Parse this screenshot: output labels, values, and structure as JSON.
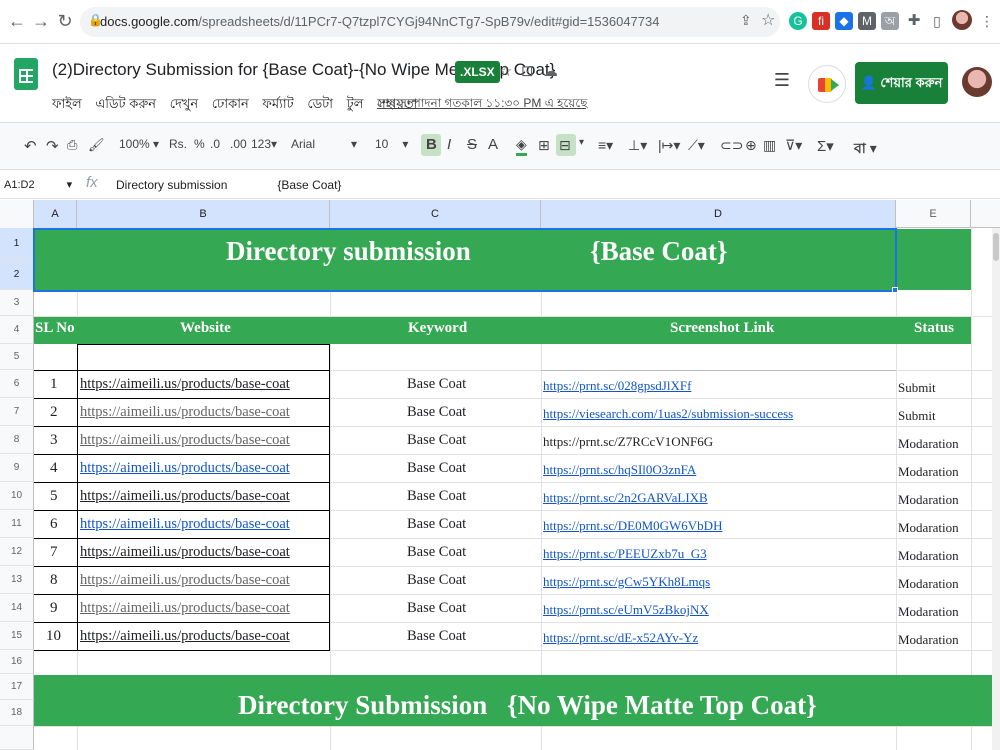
{
  "browser": {
    "url_host": "docs.google.com",
    "url_path": "/spreadsheets/d/11PCr7-Q7tzpl7CYGj94NnCTg7-SpB79v/edit#gid=1536047734"
  },
  "doc": {
    "title": "(2)Directory Submission for {Base Coat}-{No Wipe Metta Top Coat}",
    "badge": ".XLSX",
    "menu": [
      "ফাইল",
      "এডিট করুন",
      "দেখুন",
      "ঢোকান",
      "ফর্ম্যাট",
      "ডেটা",
      "টুল",
      "সহায়তা"
    ],
    "last_edit": "শেষ সম্পাদনা গতকাল ১১:৩০ PM এ হয়েছে",
    "share_label": "শেয়ার করুন"
  },
  "toolbar": {
    "zoom": "100%",
    "currency": "Rs.",
    "percent": "%",
    "dec_decrease": ".0",
    "dec_increase": ".00",
    "format_more": "123",
    "font": "Arial",
    "font_size": "10",
    "bold": "B",
    "italic": "I",
    "strike": "S",
    "text_color": "A",
    "lang": "বা"
  },
  "formula_bar": {
    "cell_ref": "A1:D2",
    "value": "Directory submission               {Base Coat}"
  },
  "columns": [
    "A",
    "B",
    "C",
    "D",
    "E"
  ],
  "rows": [
    "1",
    "2",
    "3",
    "4",
    "5",
    "6",
    "7",
    "8",
    "9",
    "10",
    "11",
    "12",
    "13",
    "14",
    "15",
    "16",
    "17",
    "18"
  ],
  "sheet": {
    "banner1": {
      "left": "Directory submission",
      "right": "{Base Coat}"
    },
    "headers": {
      "sl": "SL No",
      "website": "Website",
      "keyword": "Keyword",
      "link": "Screenshot Link",
      "status": "Status"
    },
    "entries": [
      {
        "sl": "1",
        "website": "https://aimeili.us/products/base-coat",
        "keyword": "Base Coat",
        "link": "https://prnt.sc/028gpsdJlXFf",
        "status": "Submit"
      },
      {
        "sl": "2",
        "website": "https://aimeili.us/products/base-coat",
        "keyword": "Base Coat",
        "link": "https://viesearch.com/1uas2/submission-success",
        "status": "Submit"
      },
      {
        "sl": "3",
        "website": "https://aimeili.us/products/base-coat",
        "keyword": "Base Coat",
        "link": "https://prnt.sc/Z7RCcV1ONF6G",
        "status": "Modaration"
      },
      {
        "sl": "4",
        "website": "https://aimeili.us/products/base-coat",
        "keyword": "Base Coat",
        "link": "https://prnt.sc/hqSIl0O3znFA",
        "status": "Modaration"
      },
      {
        "sl": "5",
        "website": "https://aimeili.us/products/base-coat",
        "keyword": "Base Coat",
        "link": "https://prnt.sc/2n2GARVaLIXB",
        "status": "Modaration"
      },
      {
        "sl": "6",
        "website": "https://aimeili.us/products/base-coat",
        "keyword": "Base Coat",
        "link": "https://prnt.sc/DE0M0GW6VbDH",
        "status": "Modaration"
      },
      {
        "sl": "7",
        "website": "https://aimeili.us/products/base-coat",
        "keyword": "Base Coat",
        "link": "https://prnt.sc/PEEUZxb7u_G3",
        "status": "Modaration"
      },
      {
        "sl": "8",
        "website": "https://aimeili.us/products/base-coat",
        "keyword": "Base Coat",
        "link": "https://prnt.sc/gCw5YKh8Lmqs",
        "status": "Modaration"
      },
      {
        "sl": "9",
        "website": "https://aimeili.us/products/base-coat",
        "keyword": "Base Coat",
        "link": "https://prnt.sc/eUmV5zBkojNX",
        "status": "Modaration"
      },
      {
        "sl": "10",
        "website": "https://aimeili.us/products/base-coat",
        "keyword": "Base Coat",
        "link": "https://prnt.sc/dE-x52AYv-Yz",
        "status": "Modaration"
      }
    ],
    "banner2": {
      "left": "Directory Submission",
      "right": "{No Wipe Matte Top Coat}"
    }
  },
  "colors": {
    "sheet_green": "#34a853",
    "link_blue": "#1155cc",
    "visited_gray": "#666666",
    "select_blue": "#1a73e8"
  }
}
